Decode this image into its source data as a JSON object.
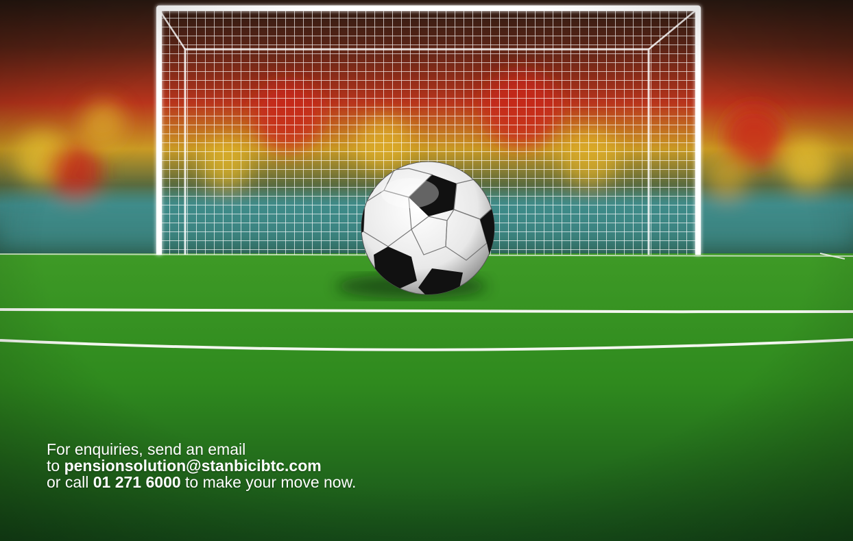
{
  "ad": {
    "line1": "For enquiries, send an email",
    "line2_prefix": "to ",
    "email": "pensionsolution@stanbicibtc.com",
    "line3_prefix": "or call ",
    "phone": "01 271 6000",
    "line3_suffix": " to make your move now."
  },
  "scene": {
    "subject": "soccer-ball",
    "background": "football-goal-with-net-and-stadium-crowd",
    "colors": {
      "pitch": "#2f8a1e",
      "pitch_dark": "#1c5a14",
      "net": "#ffffff",
      "crowd_red": "#c8261a",
      "crowd_yellow": "#e3b62a",
      "stand_teal": "#3f8c8a"
    }
  }
}
